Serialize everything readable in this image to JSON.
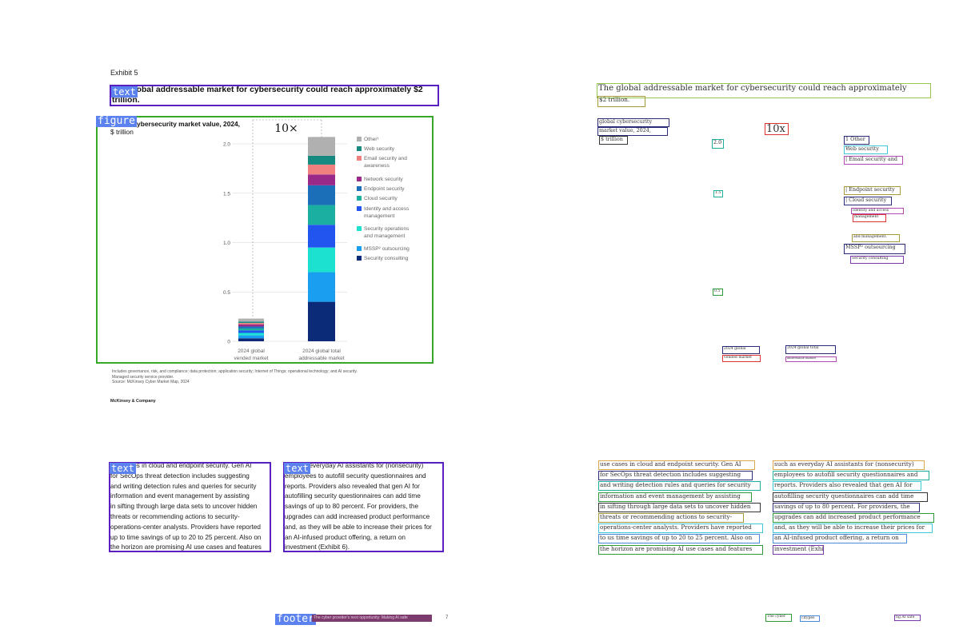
{
  "page": {
    "exhibit": "Exhibit 5",
    "title": "The global addressable market for cybersecurity could reach approximately $2 trillion.",
    "tags": {
      "text": "text",
      "figure": "figure",
      "footer": "footer"
    },
    "notes": [
      "Includes governance, risk, and compliance; data protection; application security; Internet of Things; operational technology; and AI security.",
      "Managed security service provider.",
      "Source: McKinsey Cyber Market Map, 2024"
    ],
    "publisher": "McKinsey & Company",
    "body_left": [
      "use cases in cloud and endpoint security. Gen AI",
      "for SecOps threat detection includes suggesting",
      "and writing detection rules and queries for security",
      "information and event management by assisting",
      "in sifting through large data sets to uncover hidden",
      "threats or recommending actions to security-",
      "operations-center analysts. Providers have reported",
      "up to time savings of up to 20 to 25 percent. Also on",
      "the horizon are promising AI use cases and features"
    ],
    "body_right": [
      "such as everyday AI assistants for (nonsecurity)",
      "employees to autofill security questionnaires and",
      "reports. Providers also revealed that gen AI for",
      "autofilling security questionnaires can add time",
      "savings of up to 80 percent. For providers, the",
      "upgrades can add increased product performance",
      "and, as they will be able to increase their prices for",
      "an AI-infused product offering, a return on",
      "investment (Exhibit 6)."
    ],
    "footer": "The cyber provider's next opportunity: Making AI safe",
    "page_number": "7"
  },
  "chart_data": {
    "type": "bar",
    "stacked": true,
    "title": "Global cybersecurity market value, 2024,",
    "unit": "$ trillion",
    "annotation": "10×",
    "categories": [
      "2024 global vended market",
      "2024 global total addressable market"
    ],
    "yticks": [
      0,
      0.5,
      1.0,
      1.5,
      2.0
    ],
    "ylim": [
      0,
      2.1
    ],
    "grid": true,
    "legend_position": "right",
    "series": [
      {
        "name": "Security consulting",
        "color": "#0b2a78",
        "values": [
          0.03,
          0.4
        ]
      },
      {
        "name": "MSSP² outsourcing",
        "color": "#1a9ef0",
        "values": [
          0.03,
          0.3
        ]
      },
      {
        "name": "Security operations and management",
        "color": "#1ce0d0",
        "values": [
          0.025,
          0.25
        ]
      },
      {
        "name": "Identity and access management",
        "color": "#2255f0",
        "values": [
          0.025,
          0.23
        ]
      },
      {
        "name": "Cloud security",
        "color": "#1aafa0",
        "values": [
          0.02,
          0.2
        ]
      },
      {
        "name": "Endpoint security",
        "color": "#1a6fb8",
        "values": [
          0.02,
          0.2
        ]
      },
      {
        "name": "Network security",
        "color": "#9a2a8a",
        "values": [
          0.02,
          0.11
        ]
      },
      {
        "name": "Email security and awareness",
        "color": "#f08080",
        "values": [
          0.015,
          0.1
        ]
      },
      {
        "name": "Web security",
        "color": "#168a80",
        "values": [
          0.015,
          0.09
        ]
      },
      {
        "name": "Other¹",
        "color": "#b0b0b0",
        "values": [
          0.03,
          0.19
        ]
      }
    ],
    "legend_order": [
      "Other¹",
      "Web security",
      "Email security and awareness",
      "Network security",
      "Endpoint security",
      "Cloud security",
      "Identity and access management",
      "Security operations and management",
      "MSSP² outsourcing",
      "Security consulting"
    ]
  },
  "ocr": {
    "title_1": "The global addressable market for cybersecurity could reach approximately",
    "title_2": "$2 trillion.",
    "desc_1": "global cybersecurity",
    "desc_2": "market value, 2024,",
    "desc_3": "$ trillion",
    "annotation": "10x",
    "tick_2": "2.0",
    "tick_15": "1.5",
    "tick_05": "0.5",
    "leg_other": "1 Other",
    "leg_web": "Web security",
    "leg_email": "| Email security and",
    "leg_endpoint": "| Endpoint security",
    "leg_cloud": "| Cloud security",
    "leg_ident": "Identity and access",
    "leg_manage": "management",
    "leg_secops": "and management.",
    "leg_mssp": "MSSP² outsourcing",
    "leg_consult": "Security consulting",
    "cat1_a": "2024 global",
    "cat1_b": "vended market",
    "cat2_a": "2024 global total",
    "cat2_b": "addressable market",
    "footer_a": "The cyber",
    "footer_b": "citypes",
    "footer_c": "ng AI safe",
    "body_left": [
      "use cases in cloud and endpoint security. Gen AI",
      "for SecOps threat detection includes suggesting",
      "and writing detection rules and queries for security",
      " information and event management by assisting",
      "in sifting through large data sets to uncover hidden",
      "threats or recommending actions to security-",
      "operations-center analysts. Providers have reported",
      "to us time savings of up to 20 to 25 percent. Also on",
      "the horizon are promising AI use cases and features"
    ],
    "body_right": [
      "such as everyday AI assistants for (nonsecurity)",
      "employees to autofill security questionnaires and",
      "reports. Providers also revealed that gen AI for",
      "autofilling security questionnaires can add time",
      "savings of up to 80 percent. For providers, the",
      "upgrades can add increased product performance",
      "and, as they will be able to increase their prices for",
      "an AI-infused product offering, a return on",
      " investment (Exhibit 6)."
    ]
  }
}
